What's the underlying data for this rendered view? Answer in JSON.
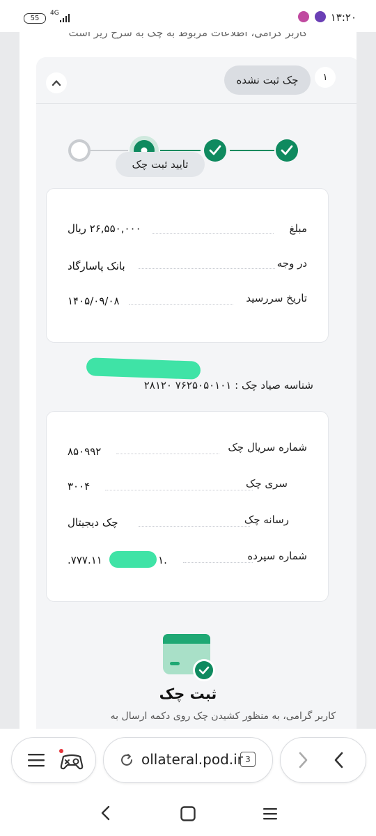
{
  "status_bar": {
    "time": "۱۳:۲۰",
    "battery": "55",
    "network": "4G"
  },
  "page": {
    "cut_text": "کاربر گرامی، اطلاعات مربوط به چک به شرح زیر است",
    "check": {
      "index": "۱",
      "status": "چک ثبت نشده",
      "confirm_label": "تایید ثبت چک",
      "steps": [
        {
          "state": "done"
        },
        {
          "state": "done"
        },
        {
          "state": "current"
        },
        {
          "state": "pending"
        }
      ],
      "summary": [
        {
          "label": "مبلغ",
          "value": "۲۶,۵۵۰,۰۰۰ ریال"
        },
        {
          "label": "در وجه",
          "value": "بانک پاسارگاد"
        },
        {
          "label": "تاریخ سررسید",
          "value": "۱۴۰۵/۰۹/۰۸"
        }
      ],
      "sayad_label": "شناسه صیاد چک :",
      "sayad_value": "۷۶۲۵۰۵۰۱۰۱ ۲۸۱۲۰",
      "details": [
        {
          "label": "شماره سریال چک",
          "value": "۸۵۰۹۹۲"
        },
        {
          "label": "سری چک",
          "value": "۳۰۰۴"
        },
        {
          "label": "رسانه چک",
          "value": "چک دیجیتال"
        },
        {
          "label": "شماره سپرده",
          "value_left": "۷۷۷.۱۱.",
          "value_right": ".۱"
        }
      ]
    },
    "register": {
      "title": "ثبت چک",
      "description": "کاربر گرامی، به منظور کشیدن چک روی دکمه ارسال به"
    }
  },
  "browser": {
    "url": "ollateral.pod.ir",
    "tab_count": "3"
  },
  "colors": {
    "accent": "#0f8a5f",
    "redaction": "#3fe3a6"
  }
}
